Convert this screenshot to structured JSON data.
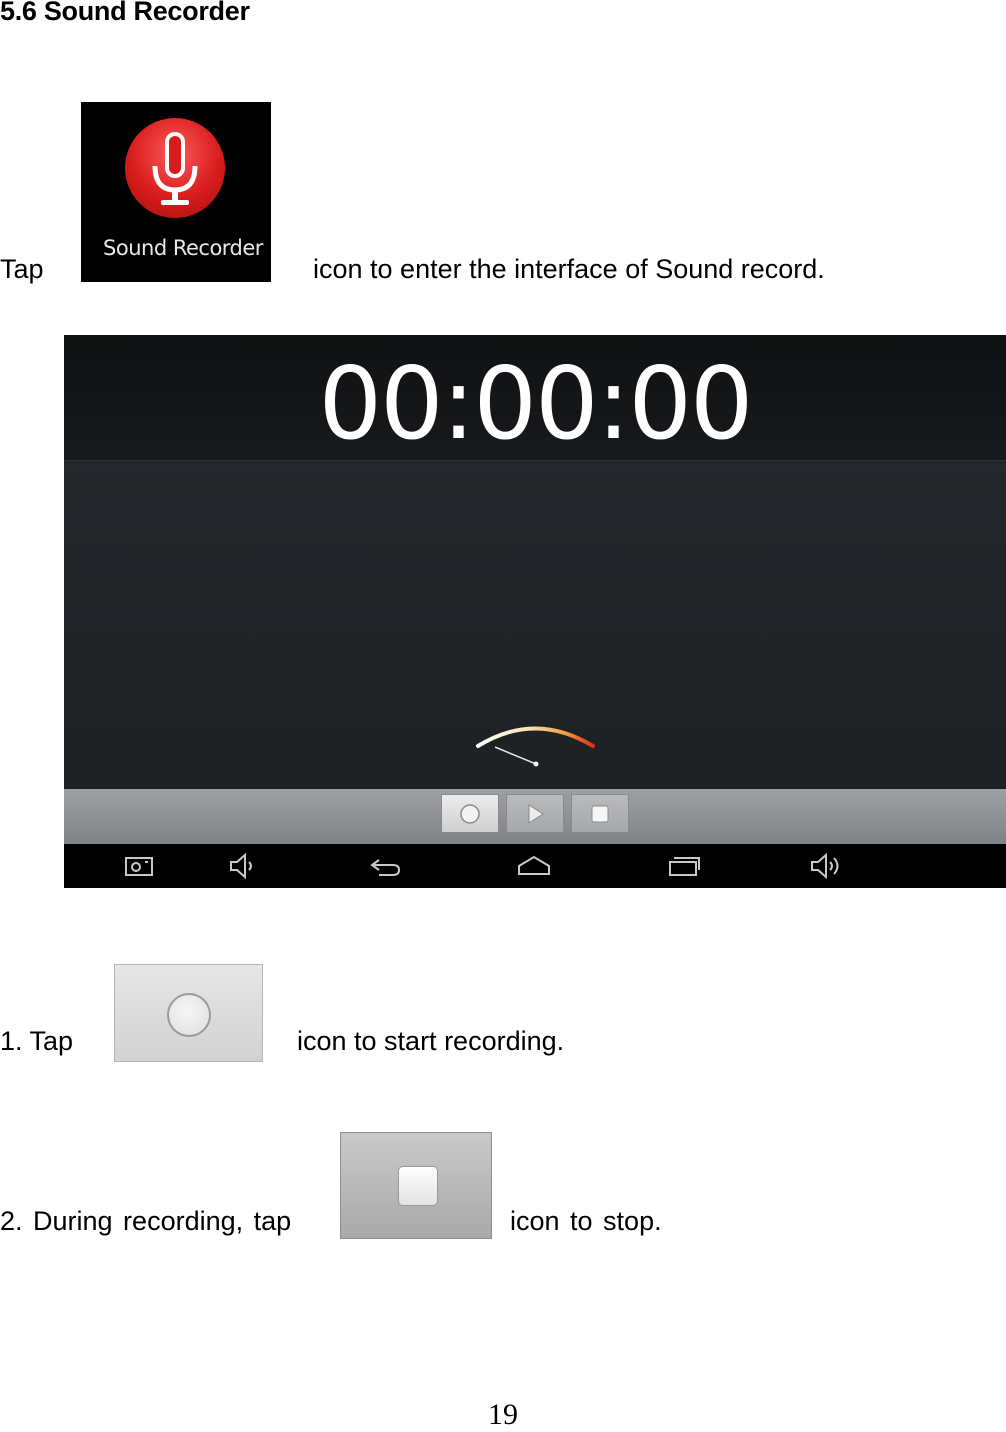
{
  "heading": "5.6 Sound Recorder",
  "intro": {
    "prefix": "Tap",
    "suffix": "icon to enter the interface of Sound record.",
    "app_icon": {
      "icon": "microphone-icon",
      "label": "Sound Recorder",
      "accent": "#d81c1c"
    }
  },
  "recorder_screen": {
    "timer": "00:00:00",
    "meter": {
      "icon": "vu-meter-icon",
      "level": 0.0
    },
    "controls": [
      {
        "icon": "record-icon"
      },
      {
        "icon": "play-icon"
      },
      {
        "icon": "stop-icon"
      }
    ],
    "nav": [
      "screenshot-icon",
      "volume-down-icon",
      "back-icon",
      "home-icon",
      "recent-apps-icon",
      "volume-up-icon"
    ]
  },
  "step1": {
    "prefix": "1. Tap",
    "suffix": "icon to start recording.",
    "icon": "record-icon"
  },
  "step2": {
    "prefix": "2. During recording, tap",
    "suffix": "icon to stop.",
    "icon": "stop-icon"
  },
  "page_number": "19"
}
